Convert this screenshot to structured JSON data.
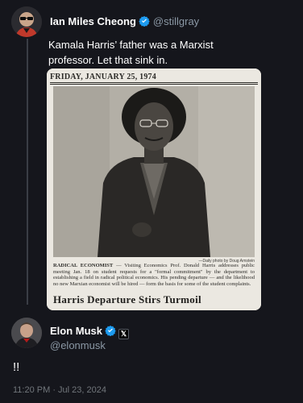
{
  "quoted_tweet": {
    "author_name": "Ian Miles Cheong",
    "author_handle": "@stillgray",
    "text_line1": "Kamala Harris’ father was a Marxist",
    "text_line2": "professor. Let that sink in.",
    "verified_color": "#1d9bf0",
    "newspaper": {
      "date": "FRIDAY, JANUARY 25, 1974",
      "photo_credit": "—Daily photo by Doug Arnstein",
      "caption_lead": "RADICAL ECONOMIST",
      "caption_line1": " — Visiting Economics Prof. Donald Harris addresses",
      "caption_line2": "public meeting Jan. 18 on student requests for a \"formal commitment\" by the",
      "caption_line3": "department to establishing a field in radical political economics. His pending",
      "caption_line4": "departure — and the likelihood no new Marxian economist will be hired — form",
      "caption_line5": "the basis for some of the student complaints.",
      "headline": "Harris Departure Stirs Turmoil"
    }
  },
  "main_tweet": {
    "author_name": "Elon Musk",
    "author_handle": "@elonmusk",
    "affiliate_badge": "𝕏",
    "text": "!!",
    "timestamp": "11:20 PM · Jul 23, 2024"
  },
  "colors": {
    "background": "#15161c",
    "text_primary": "#ffffff",
    "text_secondary": "#8b98a5",
    "verified": "#1d9bf0"
  }
}
